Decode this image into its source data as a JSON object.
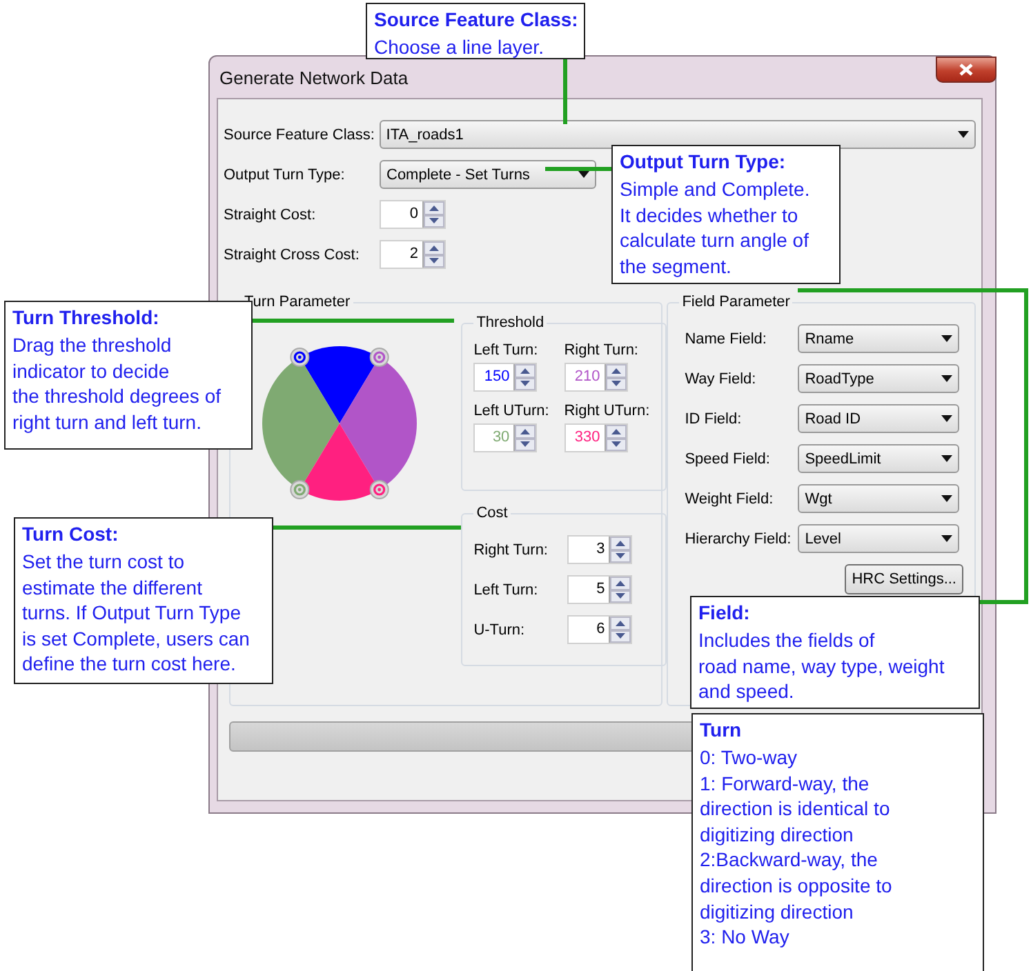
{
  "window": {
    "title": "Generate Network Data"
  },
  "form": [
    {
      "label": "Source Feature Class:",
      "kind": "dropdown",
      "value": "ITA_roads1",
      "wide": true
    },
    {
      "label": "Output Turn Type:",
      "kind": "dropdown",
      "value": "Complete - Set Turns",
      "wide": false
    },
    {
      "label": "Straight Cost:",
      "kind": "spinner",
      "value": "0"
    },
    {
      "label": "Straight Cross Cost:",
      "kind": "spinner",
      "value": "2"
    }
  ],
  "turn_parameter": {
    "title": "Turn Parameter",
    "threshold": {
      "title": "Threshold",
      "items": [
        {
          "label": "Left Turn:",
          "value": "150",
          "color": "#0000ff"
        },
        {
          "label": "Right Turn:",
          "value": "210",
          "color": "#b155c8"
        },
        {
          "label": "Left UTurn:",
          "value": "30",
          "color": "#7faa72"
        },
        {
          "label": "Right UTurn:",
          "value": "330",
          "color": "#ff2080"
        }
      ]
    },
    "cost": {
      "title": "Cost",
      "items": [
        {
          "label": "Right Turn:",
          "value": "3"
        },
        {
          "label": "Left Turn:",
          "value": "5"
        },
        {
          "label": "U-Turn:",
          "value": "6"
        }
      ]
    }
  },
  "field_parameter": {
    "title": "Field Parameter",
    "fields": [
      {
        "label": "Name Field:",
        "value": "Rname"
      },
      {
        "label": "Way Field:",
        "value": "RoadType"
      },
      {
        "label": "ID Field:",
        "value": "Road ID"
      },
      {
        "label": "Speed Field:",
        "value": "SpeedLimit"
      },
      {
        "label": "Weight Field:",
        "value": "Wgt"
      },
      {
        "label": "Hierarchy Field:",
        "value": "Level"
      }
    ],
    "button": "HRC Settings..."
  },
  "progress": {
    "level": 0
  },
  "callouts": [
    {
      "title": "Source Feature Class:",
      "lines": [
        "Choose a line layer."
      ]
    },
    {
      "title": "Output Turn Type:",
      "lines": [
        "Simple and Complete.",
        "It decides whether to",
        "calculate turn angle of",
        "the segment."
      ]
    },
    {
      "title": "Turn Threshold:",
      "lines": [
        "Drag the threshold",
        "indicator to decide",
        "the threshold degrees of",
        "right turn and left turn."
      ]
    },
    {
      "title": "Turn Cost:",
      "lines": [
        "Set the turn cost to",
        "estimate the different",
        "turns. If Output Turn Type",
        "is set Complete, users can",
        "define the turn cost here."
      ]
    },
    {
      "title": "Field:",
      "lines": [
        "Includes the fields of",
        "road name, way type, weight",
        "and speed."
      ]
    },
    {
      "title": "Turn",
      "lines": [
        "0: Two-way",
        "1: Forward-way, the",
        "direction is identical to",
        "digitizing direction",
        "2:Backward-way, the",
        "direction is opposite to",
        "digitizing direction",
        "3: No Way"
      ]
    }
  ]
}
